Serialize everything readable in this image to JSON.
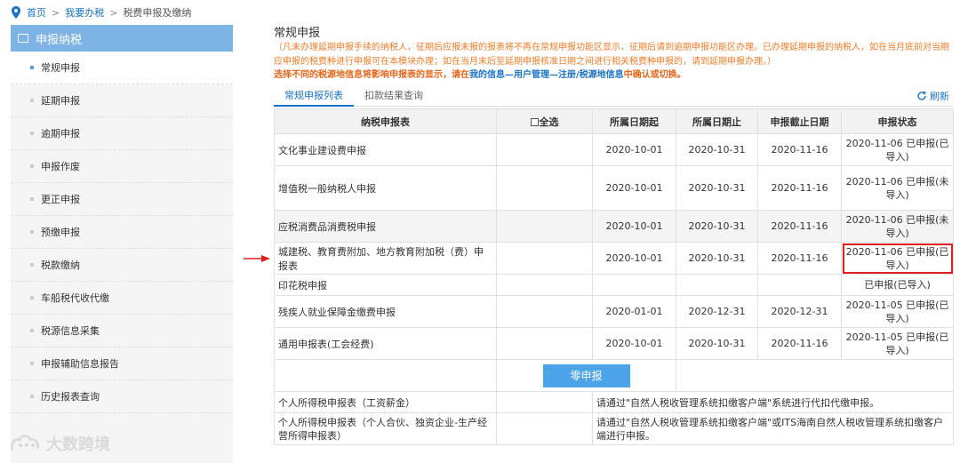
{
  "breadcrumb": {
    "home": "首页",
    "sep": ">",
    "level2": "我要办税",
    "level3": "税费申报及缴纳"
  },
  "sidebar": {
    "header": "申报纳税",
    "items": [
      {
        "label": "常规申报",
        "active": true
      },
      {
        "label": "延期申报"
      },
      {
        "label": "逾期申报"
      },
      {
        "label": "申报作废"
      },
      {
        "label": "更正申报"
      },
      {
        "label": "预缴申报"
      },
      {
        "label": "税款缴纳"
      },
      {
        "label": "车船税代收代缴"
      },
      {
        "label": "税源信息采集"
      },
      {
        "label": "申报辅助信息报告"
      },
      {
        "label": "历史报表查询"
      }
    ]
  },
  "main": {
    "title": "常规申报",
    "notice": "（凡未办理延期申报手续的纳税人，征期后应报未报的报表将不再在常规申报功能区显示，征期后请到逾期申报功能区办理。已办理延期申报的纳税人，如在当月底前对当期应申报的税费种进行申报可在本模块办理；如在当月末后至延期申报核准日期之间进行相关税费种申报的，请到延期申报办理。）",
    "warn_prefix": "选择不同的税源地信息将影响申报表的显示，请在",
    "warn_link": "我的信息—用户管理—注册/税源地信息",
    "warn_suffix": "中确认或切换。",
    "tabs": [
      "常规申报列表",
      "扣款结果查询"
    ],
    "refresh": "刷新"
  },
  "table": {
    "headers": [
      "纳税申报表",
      "全选",
      "所属日期起",
      "所属日期止",
      "申报截止日期",
      "申报状态"
    ],
    "rows": [
      {
        "name": "文化事业建设费申报",
        "start": "2020-10-01",
        "end": "2020-10-31",
        "deadline": "2020-11-16",
        "status": "2020-11-06 已申报(已导入)"
      },
      {
        "name": "增值税一般纳税人申报",
        "start": "2020-10-01",
        "end": "2020-10-31",
        "deadline": "2020-11-16",
        "status": "2020-11-06 已申报(未导入)"
      },
      {
        "name": "应税消费品消费税申报",
        "start": "2020-10-01",
        "end": "2020-10-31",
        "deadline": "2020-11-16",
        "status": "2020-11-06 已申报(未导入)"
      },
      {
        "name": "城建税、教育费附加、地方教育附加税（费）申报表",
        "start": "2020-10-01",
        "end": "2020-10-31",
        "deadline": "2020-11-16",
        "status": "2020-11-06 已申报(已导入)"
      },
      {
        "name": "印花税申报",
        "start": "",
        "end": "",
        "deadline": "",
        "status": "已申报(已导入)"
      },
      {
        "name": "残疾人就业保障金缴费申报",
        "start": "2020-01-01",
        "end": "2020-12-31",
        "deadline": "2020-12-31",
        "status": "2020-11-05 已申报(已导入)"
      },
      {
        "name": "通用申报表(工会经费)",
        "start": "2020-10-01",
        "end": "2020-10-31",
        "deadline": "2020-11-16",
        "status": "2020-11-05 已申报(已导入)"
      }
    ],
    "zero_button": "零申报",
    "personal_rows": [
      {
        "name": "个人所得税申报表（工资薪金）",
        "note": "请通过\"自然人税收管理系统扣缴客户端\"系统进行代扣代缴申报。"
      },
      {
        "name": "个人所得税申报表（个人合伙、独资企业-生产经营所得申报表）",
        "note": "请通过\"自然人税收管理系统扣缴客户端\"或ITS海南自然人税收管理系统扣缴客户端进行申报。"
      }
    ]
  },
  "watermark": "大数跨境",
  "colors": {
    "accent": "#1a73c8",
    "sidebar_header": "#7eb3e6",
    "notice": "#f07d28",
    "highlight": "#e02020",
    "button": "#4ba3e8"
  }
}
